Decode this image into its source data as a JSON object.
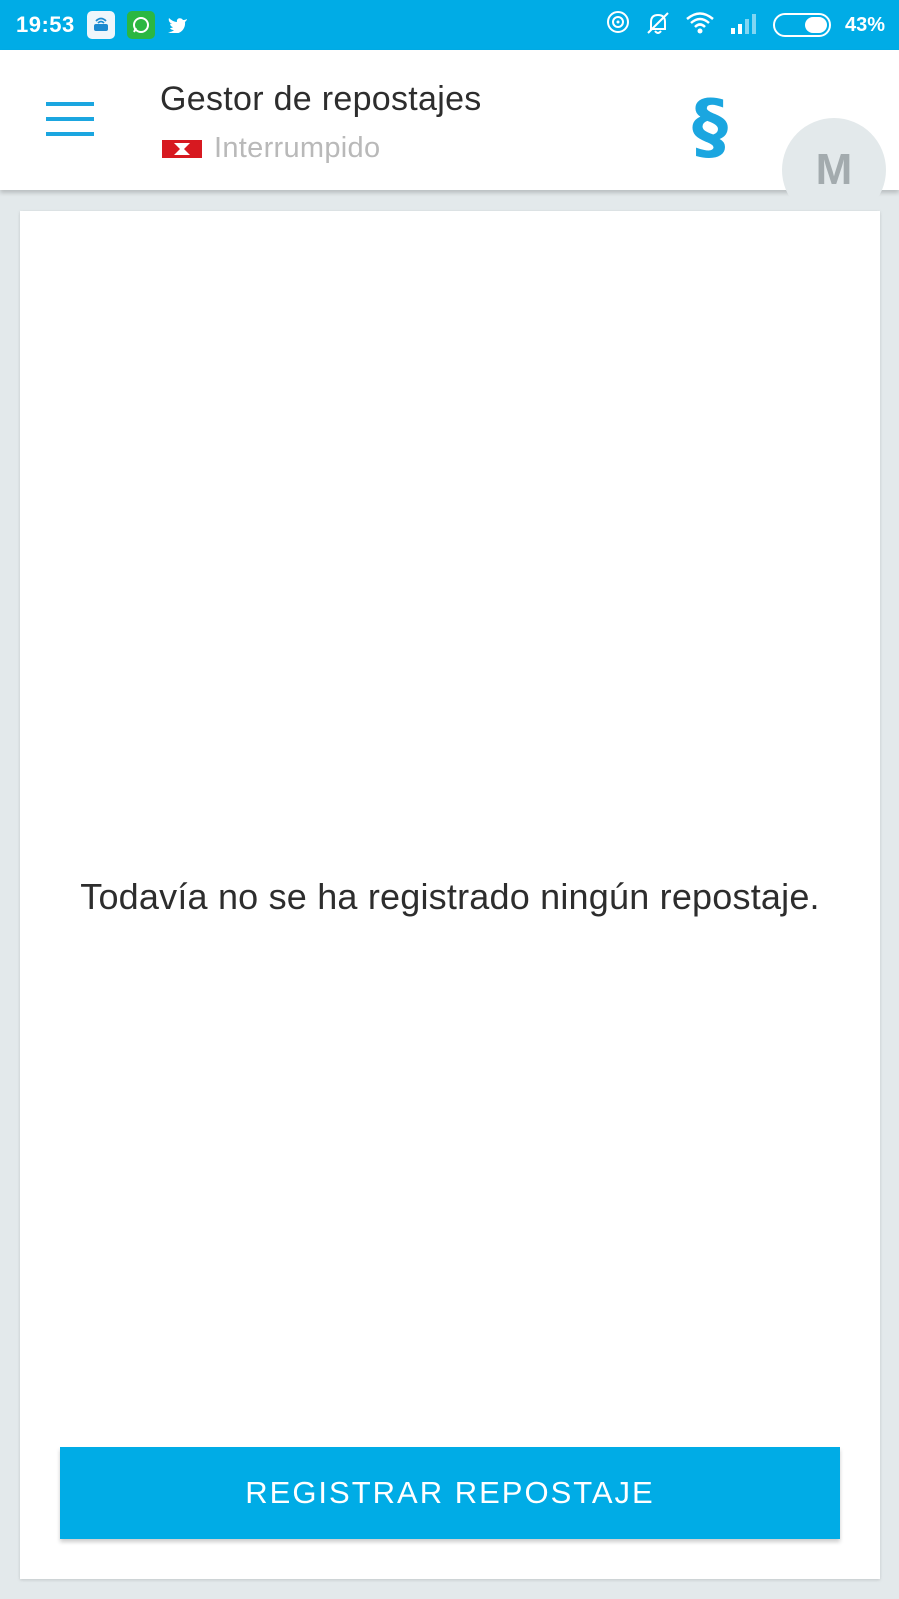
{
  "status_bar": {
    "time": "19:53",
    "notification_icons": [
      "car-wifi-app-icon",
      "whatsapp-icon",
      "twitter-icon"
    ],
    "system_icons": [
      "hotspot-icon",
      "notifications-off-icon",
      "wifi-icon",
      "signal-icon",
      "battery-icon"
    ],
    "battery_level": 0.43,
    "battery_text": "43%",
    "color": "#00ace6"
  },
  "header": {
    "menu_icon": "hamburger-menu-icon",
    "title": "Gestor de repostajes",
    "status_flag_icon": "status-flag-icon",
    "status": "Interrumpido",
    "section_symbol": "§",
    "avatar_letter": "M",
    "accent_color": "#1ba6e0"
  },
  "main": {
    "empty_message": "Todavía no se ha registrado ningún repostaje.",
    "register_button_label": "REGISTRAR REPOSTAJE"
  }
}
